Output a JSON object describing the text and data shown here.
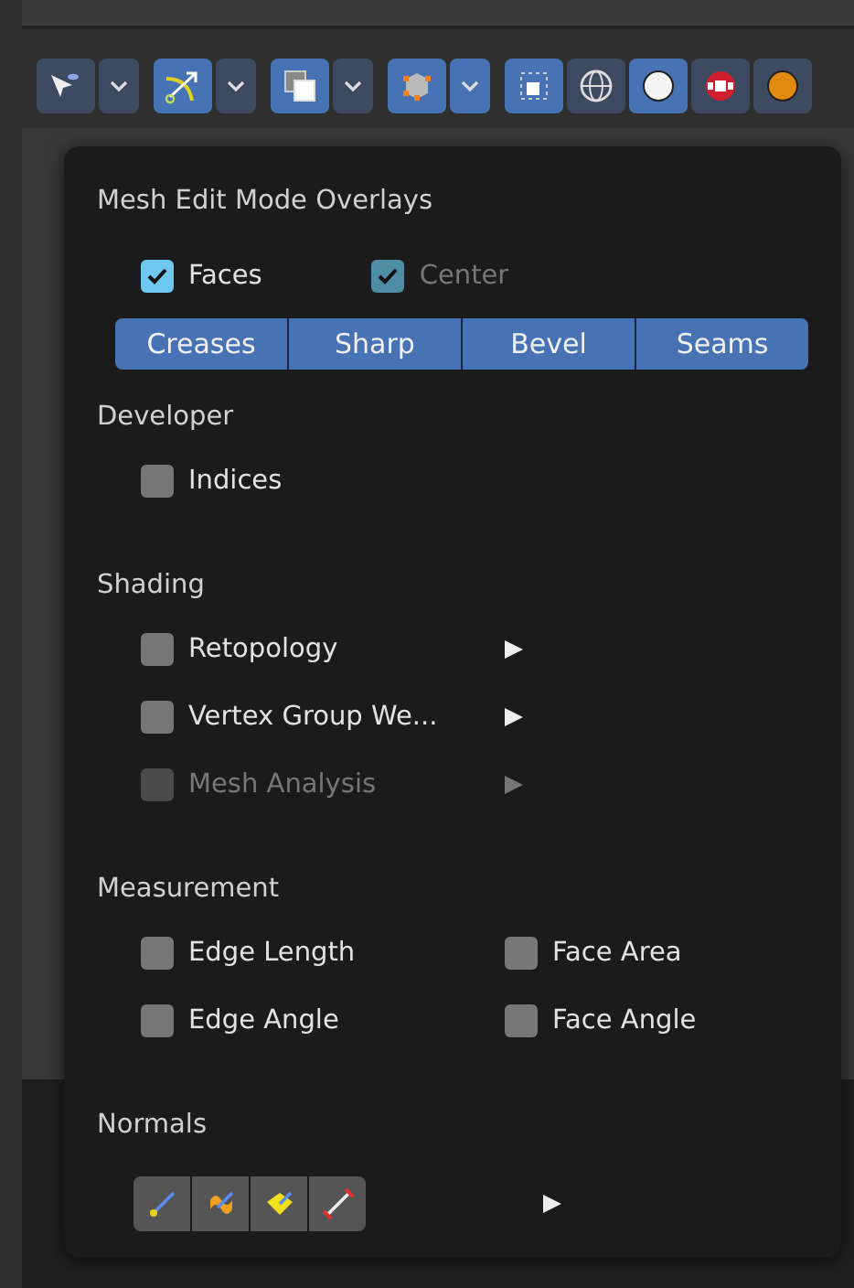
{
  "toolbar": {
    "buttons": [
      {
        "kind": "select",
        "selected": false
      },
      {
        "kind": "caret",
        "selected": false
      },
      {
        "kind": "gizmo",
        "selected": true
      },
      {
        "kind": "caret",
        "selected": false
      },
      {
        "kind": "overlay",
        "selected": true
      },
      {
        "kind": "caret",
        "selected": false
      },
      {
        "kind": "mesh",
        "selected": true
      },
      {
        "kind": "caret",
        "selected": true
      },
      {
        "kind": "xray",
        "selected": true
      },
      {
        "kind": "wire",
        "selected": false
      },
      {
        "kind": "solid",
        "selected": true
      },
      {
        "kind": "material",
        "selected": false
      },
      {
        "kind": "render",
        "selected": false
      }
    ]
  },
  "popover": {
    "title": "Mesh Edit Mode Overlays",
    "top_row": [
      {
        "label": "Faces",
        "checked": true,
        "disabled": false
      },
      {
        "label": "Center",
        "checked": true,
        "disabled": true
      }
    ],
    "segments": [
      {
        "label": "Creases",
        "selected": true
      },
      {
        "label": "Sharp",
        "selected": true
      },
      {
        "label": "Bevel",
        "selected": true
      },
      {
        "label": "Seams",
        "selected": true
      }
    ],
    "sections": [
      {
        "title": "Developer",
        "kind": "list",
        "items": [
          {
            "label": "Indices",
            "checked": false,
            "disabled": false,
            "submenu": false
          }
        ]
      },
      {
        "title": "Shading",
        "kind": "list",
        "items": [
          {
            "label": "Retopology",
            "checked": false,
            "disabled": false,
            "submenu": true
          },
          {
            "label": "Vertex Group We...",
            "checked": false,
            "disabled": false,
            "submenu": true
          },
          {
            "label": "Mesh Analysis",
            "checked": false,
            "disabled": true,
            "submenu": true
          }
        ]
      },
      {
        "title": "Measurement",
        "kind": "grid",
        "items": [
          {
            "label": "Edge Length",
            "checked": false,
            "disabled": false,
            "submenu": false
          },
          {
            "label": "Face Area",
            "checked": false,
            "disabled": false,
            "submenu": false
          },
          {
            "label": "Edge Angle",
            "checked": false,
            "disabled": false,
            "submenu": false
          },
          {
            "label": "Face Angle",
            "checked": false,
            "disabled": false,
            "submenu": false
          }
        ]
      }
    ],
    "normals": {
      "title": "Normals",
      "buttons": [
        {
          "kind": "vertex",
          "selected": false
        },
        {
          "kind": "split",
          "selected": false
        },
        {
          "kind": "face",
          "selected": false
        },
        {
          "kind": "size",
          "selected": false
        }
      ],
      "submenu": true
    }
  }
}
